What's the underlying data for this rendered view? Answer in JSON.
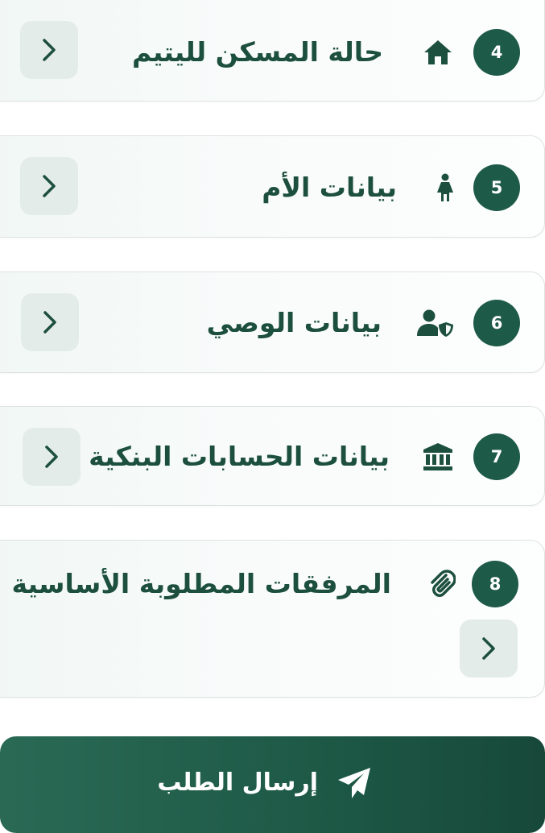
{
  "sections": [
    {
      "number": "4",
      "title": "حالة المسكن لليتيم",
      "icon": "home-icon"
    },
    {
      "number": "5",
      "title": "بيانات الأم",
      "icon": "woman-icon"
    },
    {
      "number": "6",
      "title": "بيانات الوصي",
      "icon": "user-shield-icon"
    },
    {
      "number": "7",
      "title": "بيانات الحسابات البنكية",
      "icon": "bank-icon"
    },
    {
      "number": "8",
      "title": "المرفقات المطلوبة الأساسية",
      "icon": "paperclip-icon"
    }
  ],
  "submit": {
    "label": "إرسال الطلب",
    "icon": "paper-plane-icon"
  },
  "colors": {
    "primary": "#1e5a48",
    "text": "#1d4f3f",
    "chevron_bg": "#e4ece9"
  }
}
